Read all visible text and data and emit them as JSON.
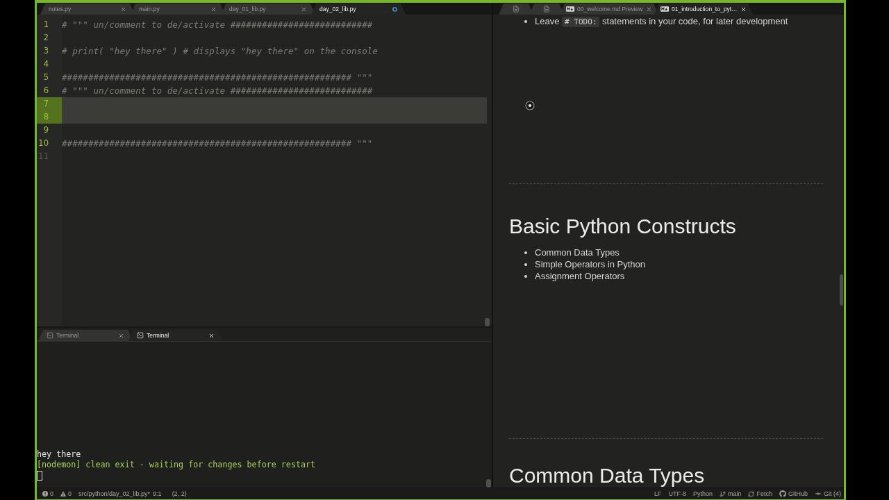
{
  "left_pane": {
    "tabs": [
      {
        "label": "notes.py",
        "selected": false,
        "modified": false
      },
      {
        "label": "main.py",
        "selected": false,
        "modified": false
      },
      {
        "label": "day_01_lib.py",
        "selected": false,
        "modified": false
      },
      {
        "label": "day_02_lib.py",
        "selected": true,
        "modified": true
      }
    ],
    "editor": {
      "lines": [
        {
          "number": "1",
          "text": "# \"\"\" un/comment to de/activate ###########################",
          "modified": true,
          "selected": false
        },
        {
          "number": "2",
          "modified": true,
          "selected": false
        },
        {
          "number": "3",
          "text": "# print( \"hey there\" ) # displays \"hey there\" on the console",
          "modified": true,
          "selected": false
        },
        {
          "number": "4",
          "modified": true,
          "selected": false
        },
        {
          "number": "5",
          "text": "####################################################### \"\"\"",
          "modified": true,
          "selected": false
        },
        {
          "number": "6",
          "text": "# \"\"\" un/comment to de/activate ###########################",
          "modified": true,
          "selected": false
        },
        {
          "number": "7",
          "modified": true,
          "selected": true
        },
        {
          "number": "8",
          "modified": true,
          "selected": true
        },
        {
          "number": "9",
          "modified": true,
          "selected": false
        },
        {
          "number": "10",
          "text": "####################################################### \"\"\"",
          "modified": true,
          "selected": false
        },
        {
          "number": "11",
          "modified": false,
          "selected": false
        }
      ]
    }
  },
  "terminal": {
    "tabs": [
      {
        "label": "Terminal",
        "selected": false
      },
      {
        "label": "Terminal",
        "selected": true
      }
    ],
    "lines": [
      {
        "kind": "output",
        "text": "hey there"
      },
      {
        "kind": "info",
        "text": "[nodemon] clean exit - waiting for changes before restart"
      }
    ]
  },
  "right_pane": {
    "tabs": [
      {
        "kind": "file",
        "selected": false
      },
      {
        "kind": "file",
        "selected": false
      },
      {
        "kind": "preview",
        "label": "00_welcome.md Preview",
        "selected": false
      },
      {
        "kind": "preview",
        "label": "01_introduction_to_pyt…",
        "selected": true
      }
    ],
    "preview": {
      "blocks": [
        {
          "kind": "list",
          "items": [
            {
              "parts": [
                {
                  "kind": "text",
                  "text": "Leave"
                },
                {
                  "kind": "code",
                  "text": "# TODO:"
                },
                {
                  "kind": "text",
                  "text": "statements in your code, for later development"
                }
              ]
            }
          ]
        },
        {
          "kind": "rule"
        },
        {
          "kind": "heading",
          "text": "Basic Python Constructs"
        },
        {
          "kind": "list",
          "items": [
            {
              "parts": [
                {
                  "kind": "text",
                  "text": "Common Data Types"
                }
              ]
            },
            {
              "parts": [
                {
                  "kind": "text",
                  "text": "Simple Operators in Python"
                }
              ]
            },
            {
              "parts": [
                {
                  "kind": "text",
                  "text": "Assignment Operators"
                }
              ]
            }
          ]
        },
        {
          "kind": "rule"
        },
        {
          "kind": "heading",
          "text": "Common Data Types"
        }
      ]
    }
  },
  "status_bar": {
    "errors": "0",
    "warnings": "0",
    "file_path": "src/python/day_02_lib.py*",
    "cursor_position": "9:1",
    "selection": "(2, 2)",
    "line_ending": "LF",
    "encoding": "UTF-8",
    "grammar": "Python",
    "branch": "main",
    "fetch": "Fetch",
    "github": "GitHub",
    "git": "Git (4)"
  }
}
